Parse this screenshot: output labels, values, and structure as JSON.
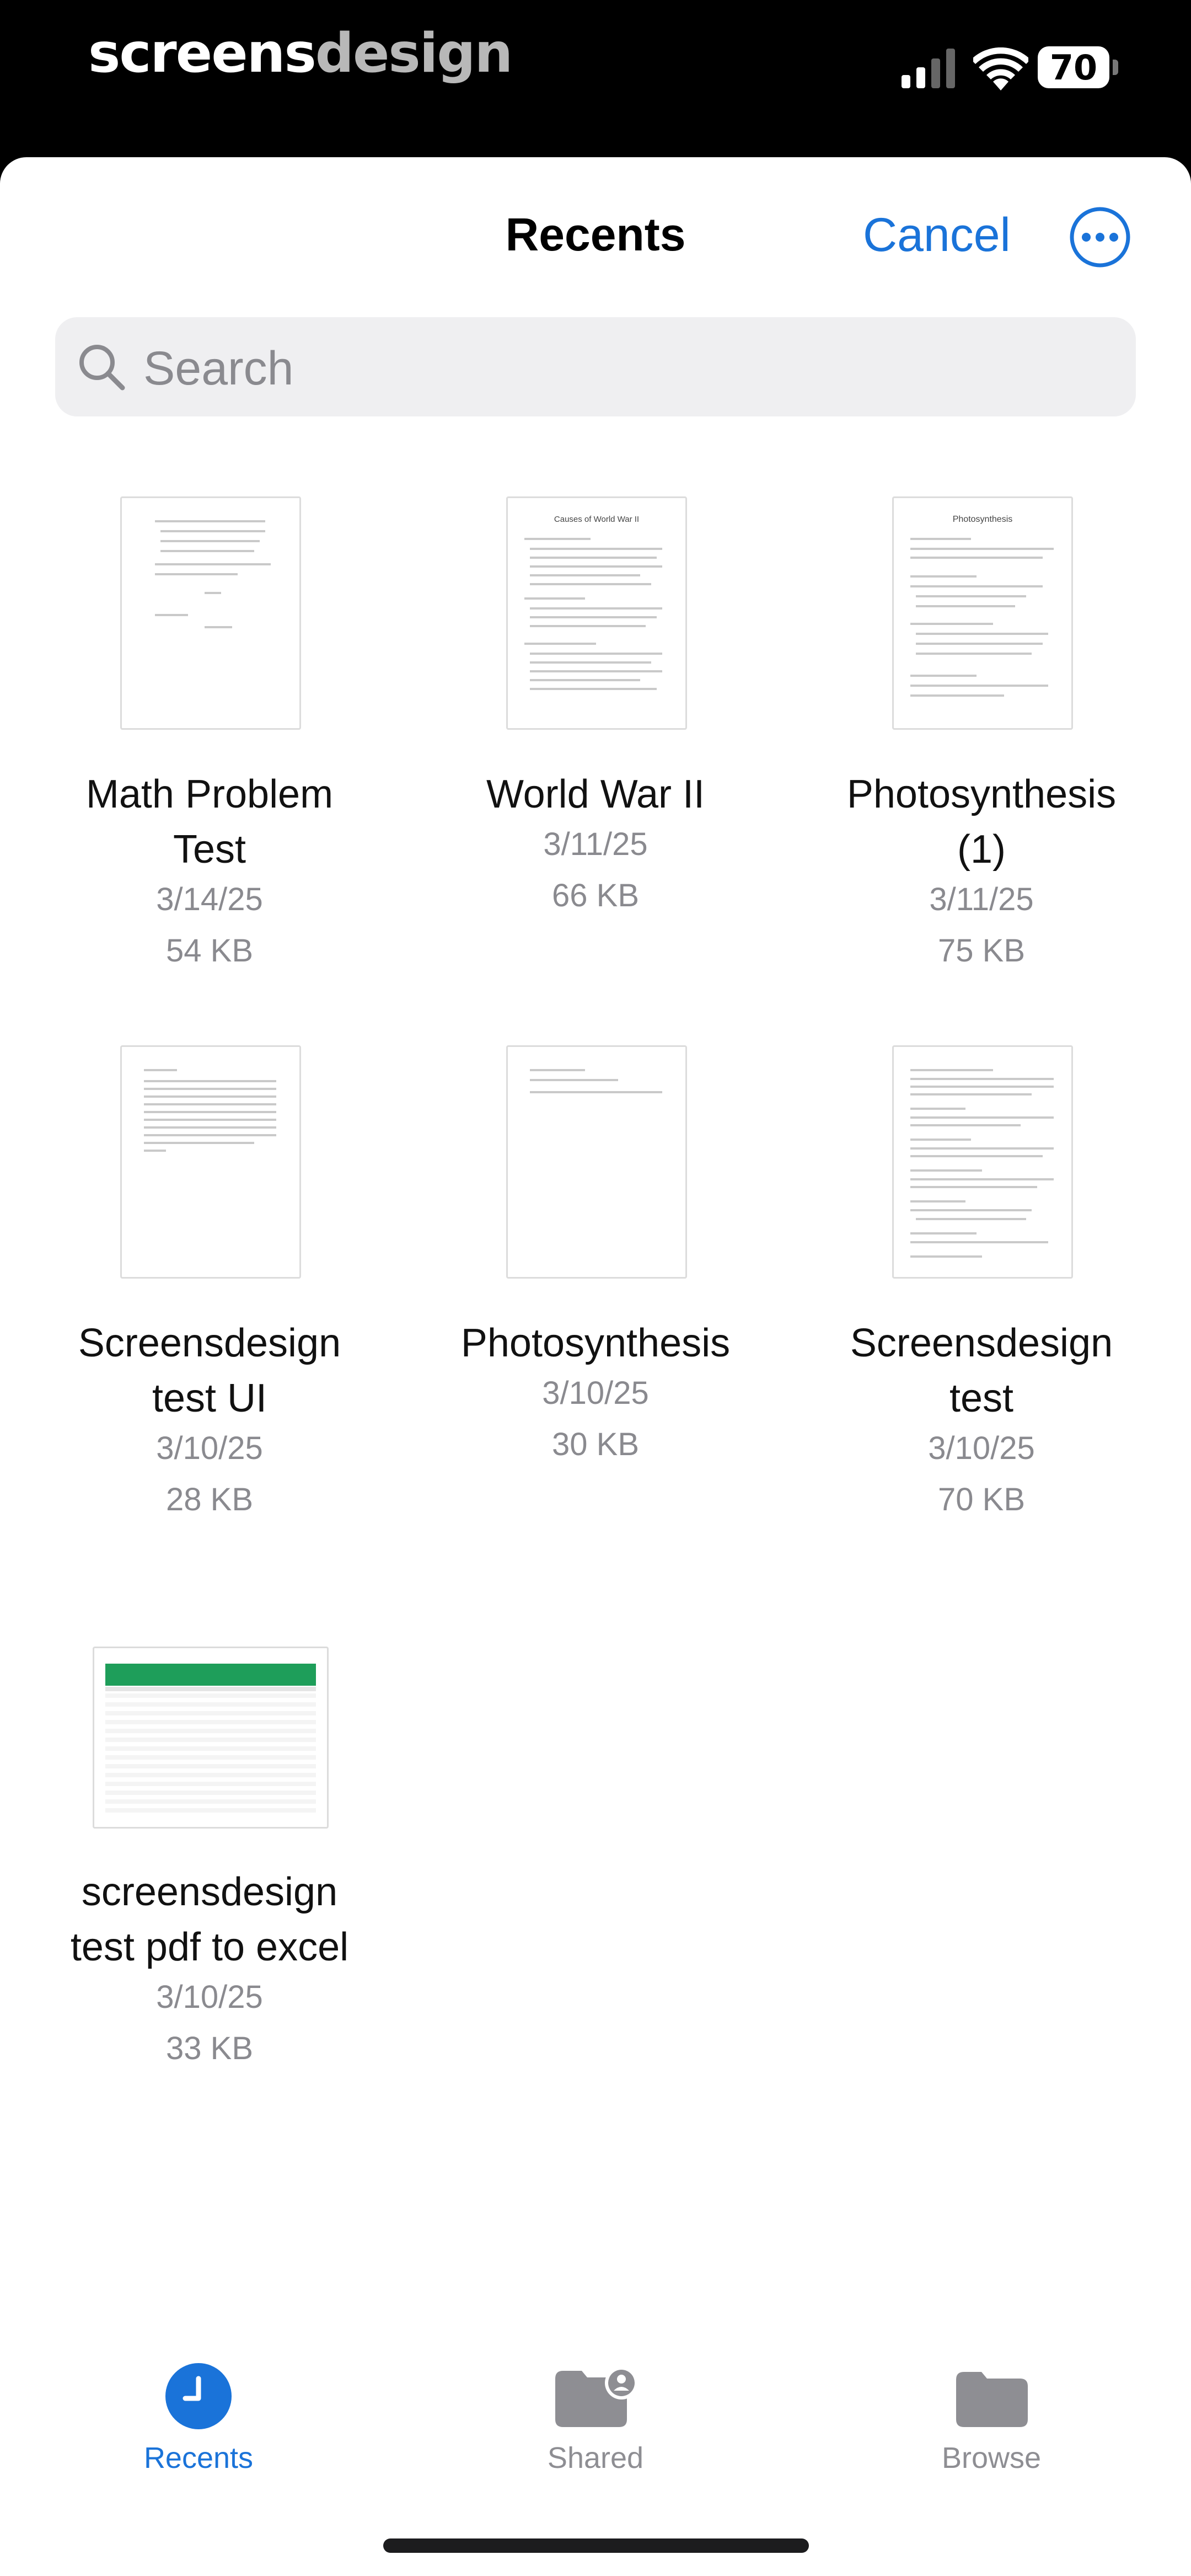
{
  "status_bar": {
    "brand_part1": "screens",
    "brand_part2": "design",
    "battery": "70"
  },
  "header": {
    "title": "Recents",
    "cancel_label": "Cancel"
  },
  "search": {
    "placeholder": "Search"
  },
  "files": [
    {
      "name_line1": "Math Problem",
      "name_line2": "Test",
      "date": "3/14/25",
      "size": "54 KB"
    },
    {
      "name_line1": "World War II",
      "name_line2": "",
      "date": "3/11/25",
      "size": "66 KB",
      "thumb_title": "Causes of World War II"
    },
    {
      "name_line1": "Photosynthesis",
      "name_line2": "(1)",
      "date": "3/11/25",
      "size": "75 KB",
      "thumb_title": "Photosynthesis"
    },
    {
      "name_line1": "Screensdesign",
      "name_line2": "test UI",
      "date": "3/10/25",
      "size": "28 KB"
    },
    {
      "name_line1": "Photosynthesis",
      "name_line2": "",
      "date": "3/10/25",
      "size": "30 KB"
    },
    {
      "name_line1": "Screensdesign",
      "name_line2": "test",
      "date": "3/10/25",
      "size": "70 KB"
    },
    {
      "name_line1": "screensdesign",
      "name_line2": "test pdf to excel",
      "date": "3/10/25",
      "size": "33 KB"
    }
  ],
  "tabs": [
    {
      "label": "Recents",
      "active": true
    },
    {
      "label": "Shared",
      "active": false
    },
    {
      "label": "Browse",
      "active": false
    }
  ],
  "colors": {
    "accent": "#1a73d9",
    "tab_inactive": "#8e8e93",
    "sheet_green": "#1e9e5a"
  }
}
